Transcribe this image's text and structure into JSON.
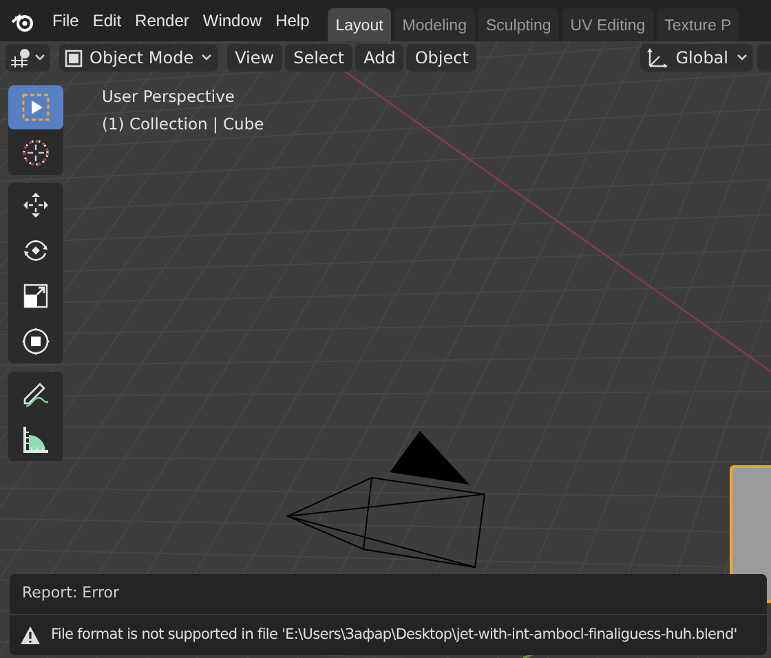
{
  "menu": [
    "File",
    "Edit",
    "Render",
    "Window",
    "Help"
  ],
  "workspace_tabs": [
    {
      "label": "Layout",
      "selected": true
    },
    {
      "label": "Modeling",
      "selected": false
    },
    {
      "label": "Sculpting",
      "selected": false
    },
    {
      "label": "UV Editing",
      "selected": false
    },
    {
      "label": "Texture P",
      "selected": false
    }
  ],
  "header": {
    "mode": "Object Mode",
    "menus": [
      "View",
      "Select",
      "Add",
      "Object"
    ],
    "orientation": "Global"
  },
  "viewport": {
    "view_name": "User Perspective",
    "context": "(1) Collection | Cube"
  },
  "tools": [
    {
      "kind": "select",
      "selected": true
    },
    {
      "kind": "cursor",
      "selected": false
    },
    {
      "kind": "move",
      "selected": false
    },
    {
      "kind": "rotate",
      "selected": false
    },
    {
      "kind": "scale",
      "selected": false
    },
    {
      "kind": "transform",
      "selected": false
    },
    {
      "kind": "annotate",
      "selected": false
    },
    {
      "kind": "measure",
      "selected": false
    }
  ],
  "report": {
    "title": "Report: Error",
    "message": "File format is not supported in file 'E:\\Users\\Зафар\\Desktop\\jet-with-int-ambocl-finaliguess-huh.blend'"
  }
}
